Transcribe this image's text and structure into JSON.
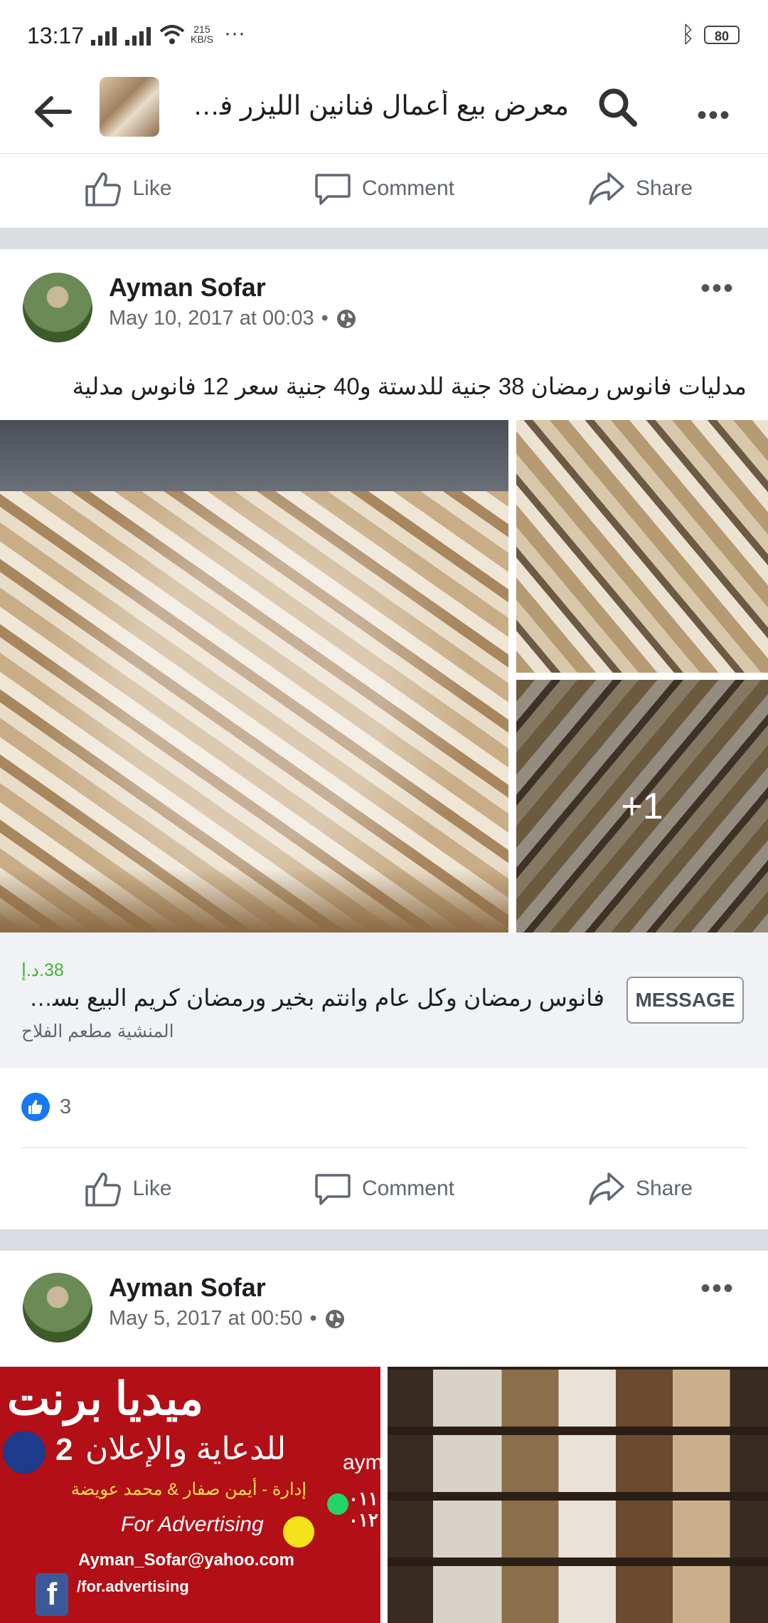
{
  "status_bar": {
    "time": "13:17",
    "speed_value": "215",
    "speed_unit": "KB/S",
    "dots": "···",
    "battery": "80"
  },
  "app_bar": {
    "title": "معرض بيع أعمال فنانين الليزر في الش...",
    "back_icon": "back-arrow-icon",
    "search_icon": "search-icon",
    "more": "•••"
  },
  "actions": {
    "like": "Like",
    "comment": "Comment",
    "share": "Share"
  },
  "post1": {
    "author": "Ayman Sofar",
    "date": "May 10, 2017 at 00:03",
    "dot": "•",
    "more": "•••",
    "text": "مدليات فانوس رمضان  38 جنية للدستة و40 جنية سعر 12 فانوس مدلية",
    "more_photos": "+1",
    "marketplace": {
      "price": "38.د.إ",
      "title": "فانوس رمضان  وكل عام وانتم بخير ورمضان كريم البيع بسع...",
      "location": "المنشية مطعم الفلاح",
      "message_button": "MESSAGE"
    },
    "likes_count": "3"
  },
  "post2": {
    "author": "Ayman Sofar",
    "date": "May 5, 2017 at 00:50",
    "dot": "•",
    "more": "•••",
    "ad_lines": {
      "brand": "ميديا برنت",
      "tagline": "للدعاية والإعلان",
      "number": "2",
      "management": "إدارة - أيمن صفار & محمد عويضة",
      "english": "For Advertising",
      "email": "Ayman_Sofar@yahoo.com",
      "fb": "/for.advertising",
      "side": "aym",
      "phone1": "٠١١",
      "phone2": "٠١٢"
    }
  },
  "colors": {
    "facebook_blue": "#1877f2",
    "price_green": "#42b72a",
    "separator": "#dadde1",
    "ad_red": "#b30f16"
  }
}
